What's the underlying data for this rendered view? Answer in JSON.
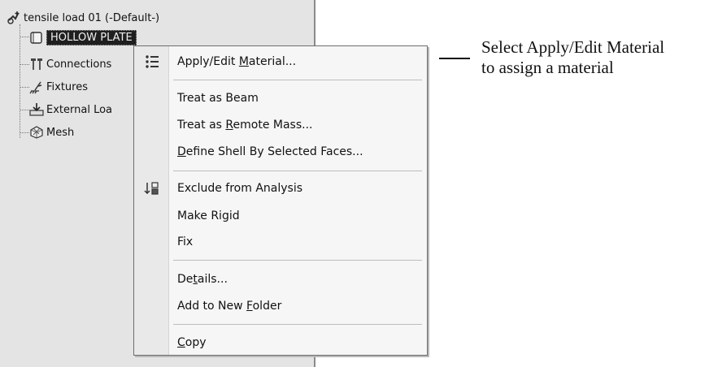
{
  "tree": {
    "root": "tensile load 01 (-Default-)",
    "items": [
      {
        "label": "HOLLOW PLATE",
        "icon": "solid-body-icon",
        "selected": true
      },
      {
        "label": "Connections",
        "icon": "connections-icon"
      },
      {
        "label": "Fixtures",
        "icon": "fixtures-icon"
      },
      {
        "label": "External Loa",
        "icon": "external-loads-icon"
      },
      {
        "label": "Mesh",
        "icon": "mesh-icon"
      }
    ]
  },
  "menu": {
    "apply_edit_material": {
      "pre": "Apply/Edit ",
      "key": "M",
      "post": "aterial..."
    },
    "treat_as_beam": "Treat as Beam",
    "treat_remote_mass": {
      "pre": "Treat as ",
      "key": "R",
      "post": "emote Mass..."
    },
    "define_shell": {
      "pre": "",
      "key": "D",
      "post": "efine Shell By Selected Faces..."
    },
    "exclude": "Exclude from Analysis",
    "make_rigid": "Make Rigid",
    "fix": "Fix",
    "details": {
      "pre": "De",
      "key": "t",
      "post": "ails..."
    },
    "add_folder": {
      "pre": "Add to New ",
      "key": "F",
      "post": "older"
    },
    "copy": {
      "pre": "",
      "key": "C",
      "post": "opy"
    }
  },
  "callout": {
    "line1": "Select Apply/Edit Material",
    "line2": "to assign a material"
  }
}
